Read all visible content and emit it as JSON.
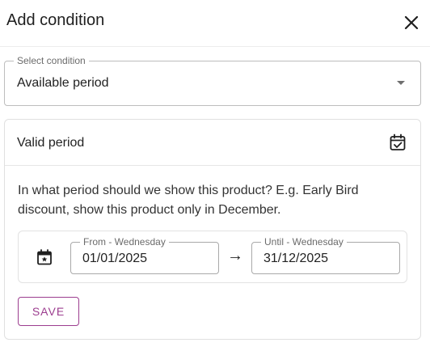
{
  "dialog": {
    "title": "Add condition",
    "close_icon": "close-icon"
  },
  "condition_select": {
    "label": "Select condition",
    "value": "Available period",
    "caret_icon": "dropdown-caret-icon"
  },
  "card": {
    "title": "Valid period",
    "icon": "calendar-check-icon",
    "description": "In what period should we show this product? E.g. Early Bird discount, show this product only in December.",
    "range_icon": "calendar-star-icon",
    "from": {
      "label": "From - Wednesday",
      "value": "01/01/2025"
    },
    "arrow": "→",
    "until": {
      "label": "Until - Wednesday",
      "value": "31/12/2025"
    },
    "save_label": "SAVE"
  },
  "colors": {
    "accent": "#9c3d8f",
    "border": "#e0e0e0",
    "text": "#222222"
  }
}
